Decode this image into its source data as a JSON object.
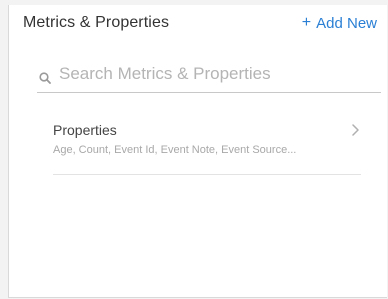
{
  "header": {
    "title": "Metrics & Properties",
    "add_new_plus": "+",
    "add_new_label": "Add New"
  },
  "search": {
    "placeholder": "Search Metrics & Properties",
    "value": "",
    "icon": "search-icon"
  },
  "list": {
    "items": [
      {
        "label": "Properties",
        "subtitle": "Age, Count, Event Id, Event Note, Event Source...",
        "icon": "chevron-right-icon"
      }
    ]
  },
  "colors": {
    "accent": "#2a7fd4",
    "title_text": "#333333",
    "muted_text": "#a8a8a8",
    "placeholder": "#b4b4b4"
  }
}
